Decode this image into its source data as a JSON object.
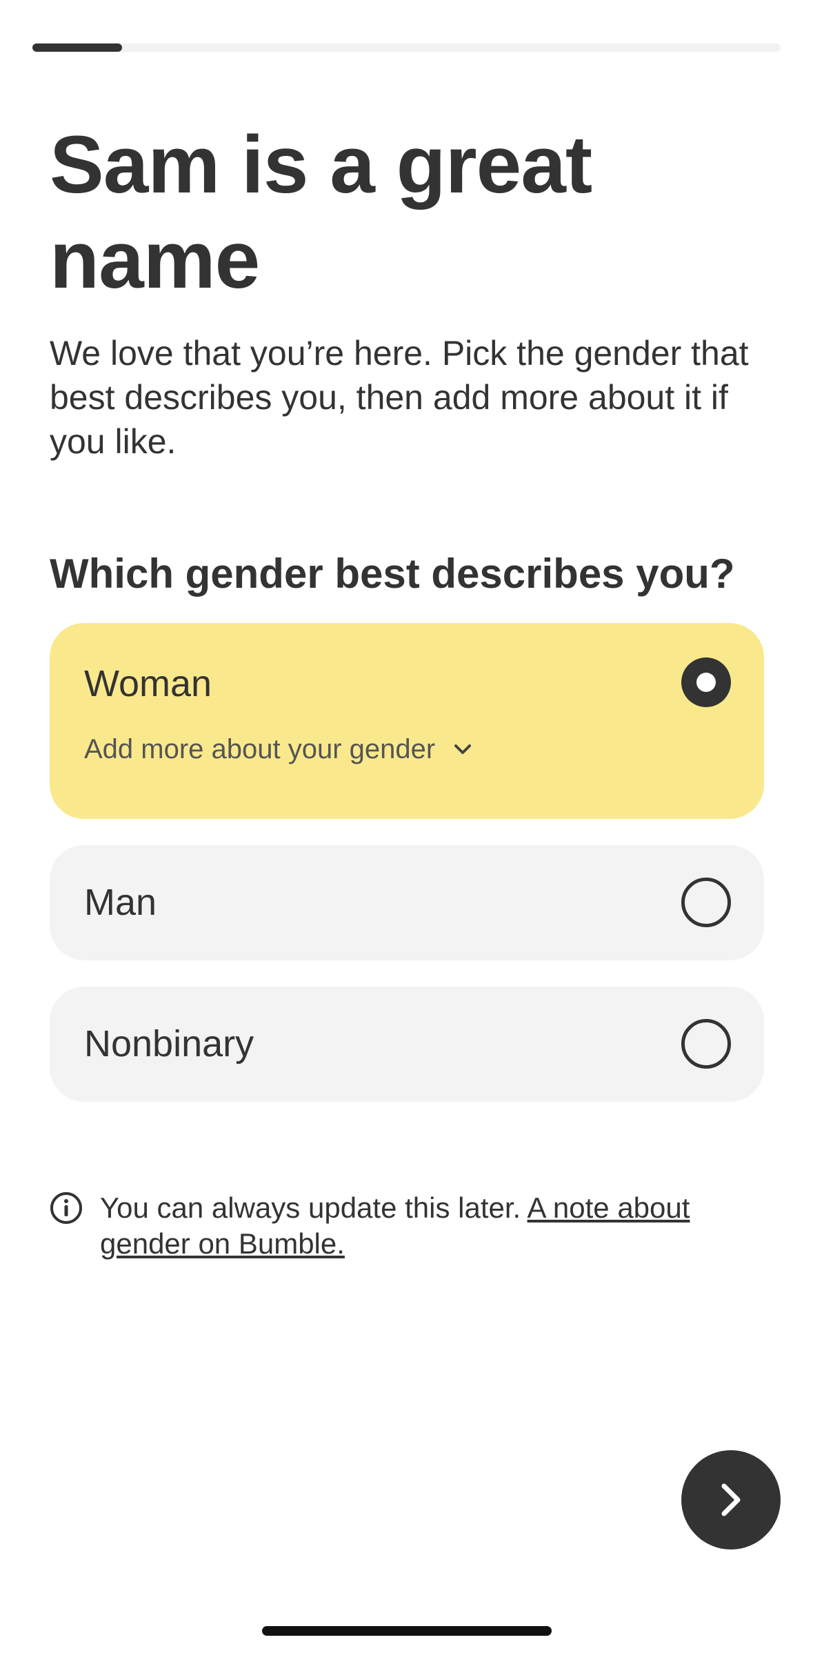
{
  "progress": {
    "fraction": 0.12
  },
  "header": {
    "title": "Sam is a great name",
    "subtitle": "We love that you’re here. Pick the gender that best describes you, then add more about it if you like."
  },
  "question": "Which gender best describes you?",
  "options": [
    {
      "label": "Woman",
      "selected": true,
      "more_label": "Add more about your gender"
    },
    {
      "label": "Man",
      "selected": false
    },
    {
      "label": "Nonbinary",
      "selected": false
    }
  ],
  "note": {
    "text": "You can always update this later. ",
    "link": "A note about gender on Bumble."
  },
  "icons": {
    "info": "info-icon",
    "expand": "chevron-down-icon",
    "next": "chevron-right-icon"
  },
  "colors": {
    "selected_bg": "#fae98c",
    "option_bg": "#f3f3f3",
    "dark": "#333333"
  }
}
